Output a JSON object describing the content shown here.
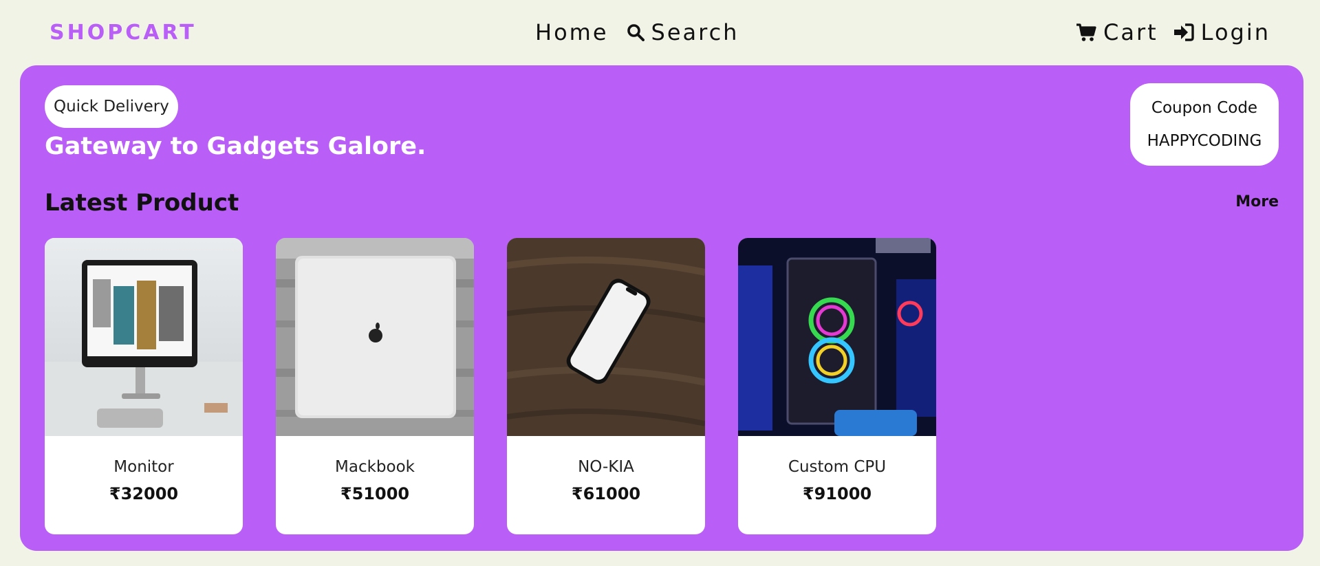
{
  "nav": {
    "logo": "SHOPCART",
    "home": "Home",
    "search": "Search",
    "cart": "Cart",
    "login": "Login"
  },
  "hero": {
    "badge": "Quick Delivery",
    "tagline": "Gateway to Gadgets Galore.",
    "coupon_label": "Coupon Code",
    "coupon_code": "HAPPYCODING"
  },
  "section": {
    "title": "Latest Product",
    "more": "More"
  },
  "products": [
    {
      "name": "Monitor",
      "price": "₹32000"
    },
    {
      "name": "Mackbook",
      "price": "₹51000"
    },
    {
      "name": "NO-KIA",
      "price": "₹61000"
    },
    {
      "name": "Custom CPU",
      "price": "₹91000"
    }
  ],
  "colors": {
    "accent": "#b95ff8",
    "page_bg": "#f0f3e6",
    "card_bg": "#ffffff"
  },
  "icons": [
    "search-icon",
    "cart-icon",
    "login-icon"
  ]
}
